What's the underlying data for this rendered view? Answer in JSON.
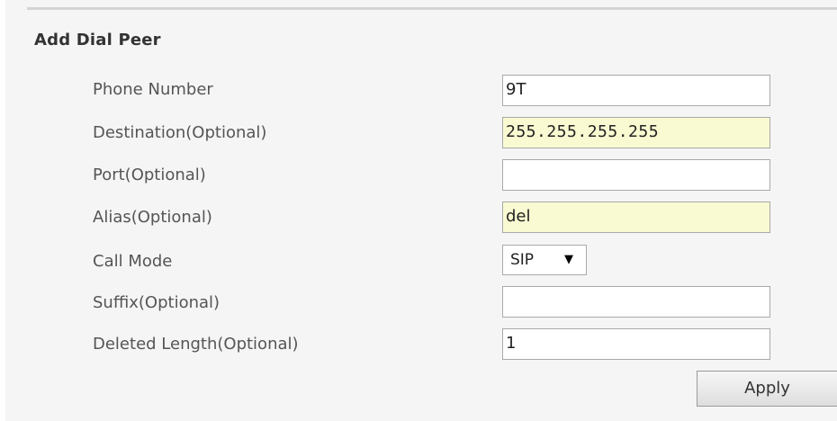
{
  "form": {
    "title": "Add Dial Peer",
    "fields": {
      "phone_number": {
        "label": "Phone Number",
        "value": "9T"
      },
      "destination": {
        "label": "Destination(Optional)",
        "value": "255.255.255.255"
      },
      "port": {
        "label": "Port(Optional)",
        "value": ""
      },
      "alias": {
        "label": "Alias(Optional)",
        "value": "del"
      },
      "call_mode": {
        "label": "Call Mode",
        "selected": "SIP"
      },
      "suffix": {
        "label": "Suffix(Optional)",
        "value": ""
      },
      "deleted_length": {
        "label": "Deleted Length(Optional)",
        "value": "1"
      }
    },
    "apply_label": "Apply"
  },
  "icons": {
    "dropdown": "caret-down-icon"
  },
  "colors": {
    "panel_background": "#f5f5f5",
    "autofill_highlight": "#fafad2",
    "field_border": "#a9a9a9"
  }
}
